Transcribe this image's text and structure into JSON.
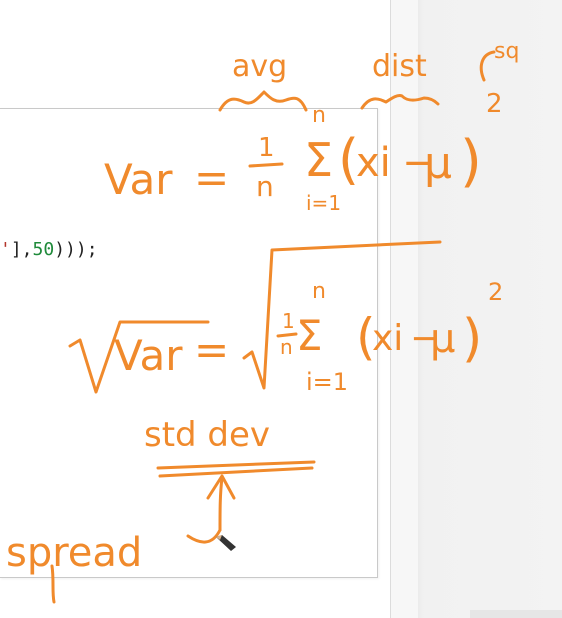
{
  "code": {
    "visible_fragment_part1": "'",
    "visible_fragment_part2": "],",
    "visible_fragment_number": "50",
    "visible_fragment_part3": ")));"
  },
  "annotations": {
    "avg": "avg",
    "dist": "dist",
    "sq": "sq",
    "var_label": "Var",
    "equals": "=",
    "std_dev": "std dev",
    "spread": "spread",
    "one": "1",
    "n": "n",
    "sum": "Σ",
    "i_eq_1": "i=1",
    "lparen": "(",
    "rparen": ")",
    "x_i": "xi",
    "minus": "−",
    "mu": "μ",
    "two": "2"
  },
  "colors": {
    "ink": "#f08a2c",
    "code_string": "#b3362c",
    "code_number": "#1f8a3a"
  }
}
